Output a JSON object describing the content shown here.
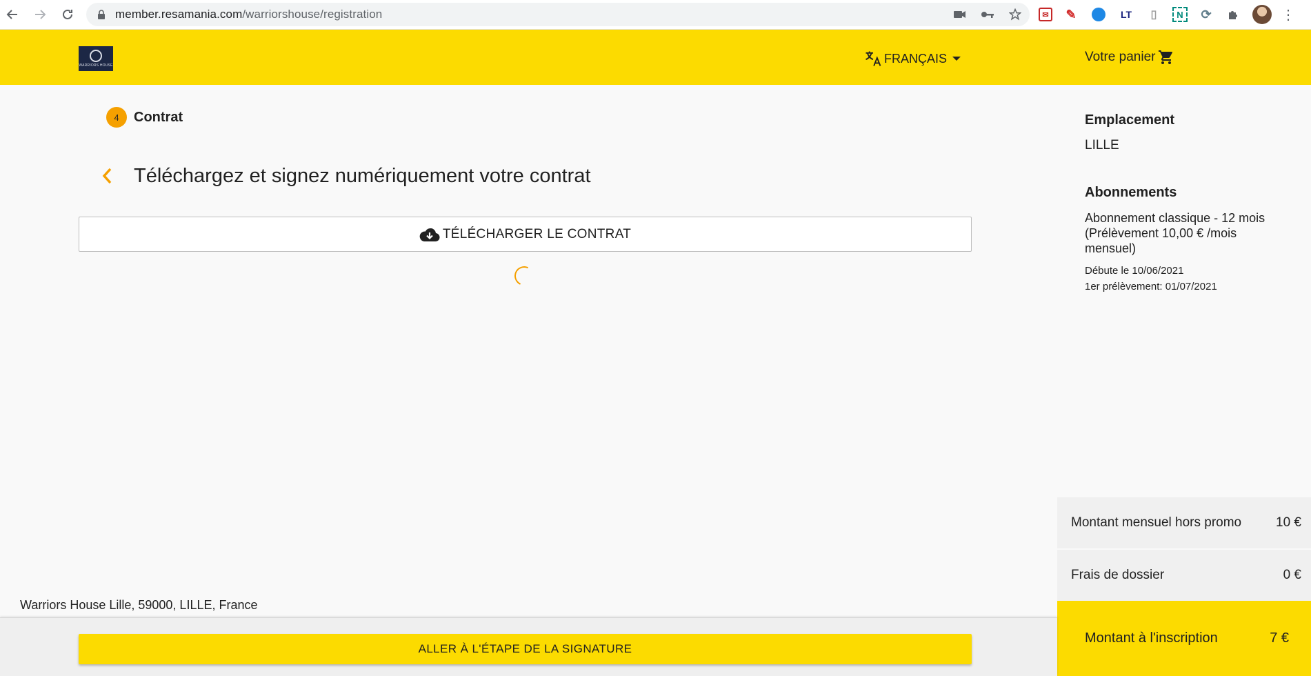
{
  "browser": {
    "url_domain": "member.resamania.com",
    "url_path": "/warriorshouse/registration"
  },
  "header": {
    "logo_text": "WARRIORS HOUSE",
    "language": "FRANÇAIS",
    "cart_label": "Votre panier"
  },
  "step": {
    "number": "4",
    "label": "Contrat"
  },
  "main": {
    "title": "Téléchargez et signez numériquement votre contrat",
    "download_label": "TÉLÉCHARGER LE CONTRAT"
  },
  "sidebar": {
    "location_heading": "Emplacement",
    "location_value": "LILLE",
    "subscriptions_heading": "Abonnements",
    "plan_description": "Abonnement classique - 12 mois (Prélèvement 10,00 € /mois mensuel)",
    "start_date": "Débute le 10/06/2021",
    "first_debit": "1er prélèvement: 01/07/2021"
  },
  "summary": {
    "monthly_label": "Montant mensuel hors promo",
    "monthly_value": "10 €",
    "fees_label": "Frais de dossier",
    "fees_value": "0 €",
    "total_label": "Montant à l'inscription",
    "total_value": "7 €"
  },
  "footer": {
    "address": "Warriors House Lille, 59000, LILLE, France",
    "sign_button": "ALLER À L'ÉTAPE DE LA SIGNATURE"
  },
  "colors": {
    "brand_yellow": "#fcdb00",
    "accent_orange": "#f5a000"
  }
}
